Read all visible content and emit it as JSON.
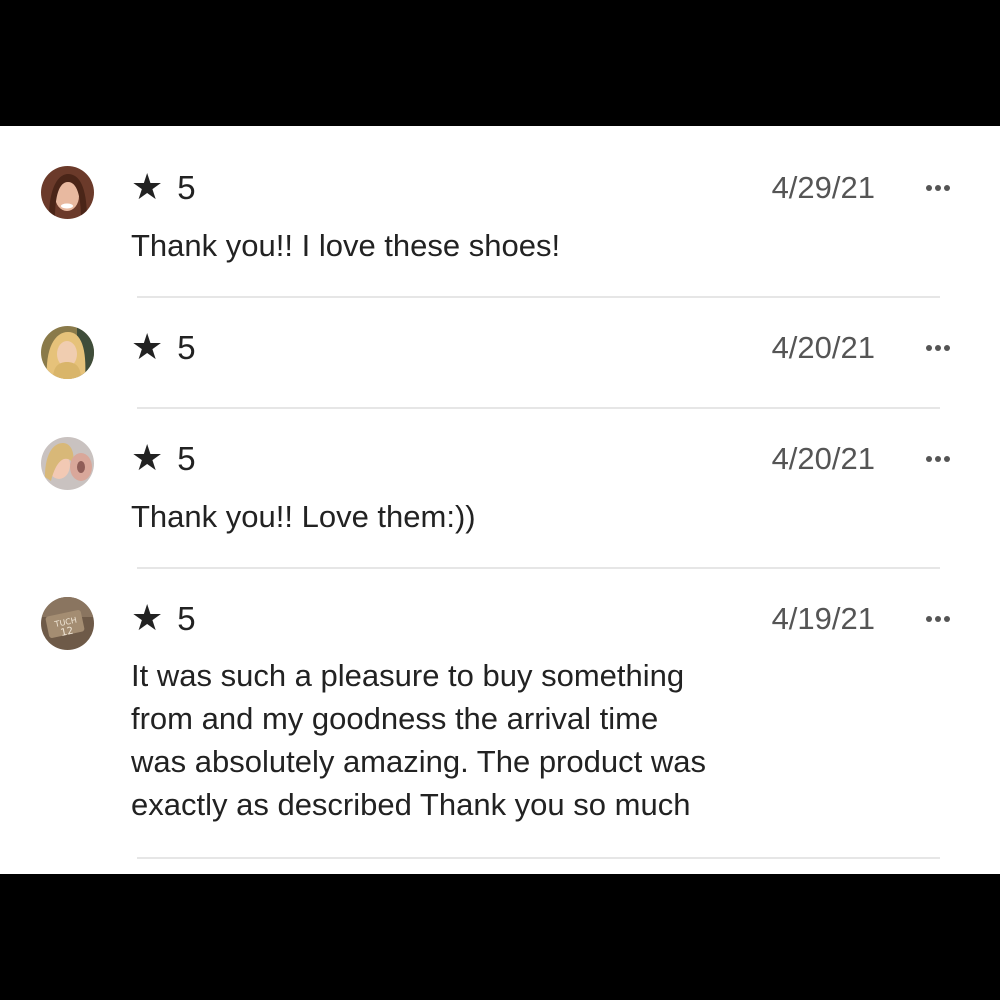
{
  "reviews": [
    {
      "rating": "5",
      "date": "4/29/21",
      "comment": "Thank you!! I love these shoes!"
    },
    {
      "rating": "5",
      "date": "4/20/21",
      "comment": ""
    },
    {
      "rating": "5",
      "date": "4/20/21",
      "comment": "Thank you!! Love them:))"
    },
    {
      "rating": "5",
      "date": "4/19/21",
      "comment": "It was such a pleasure to buy something\nfrom and my goodness the arrival time\nwas absolutely amazing. The product was\nexactly as described Thank you so much"
    }
  ],
  "icons": {
    "star": "star-icon",
    "more": "more-options-icon"
  },
  "colors": {
    "text": "#222222",
    "secondary_text": "#555555",
    "divider": "#e6e6e6",
    "background": "#ffffff",
    "frame": "#000000"
  }
}
